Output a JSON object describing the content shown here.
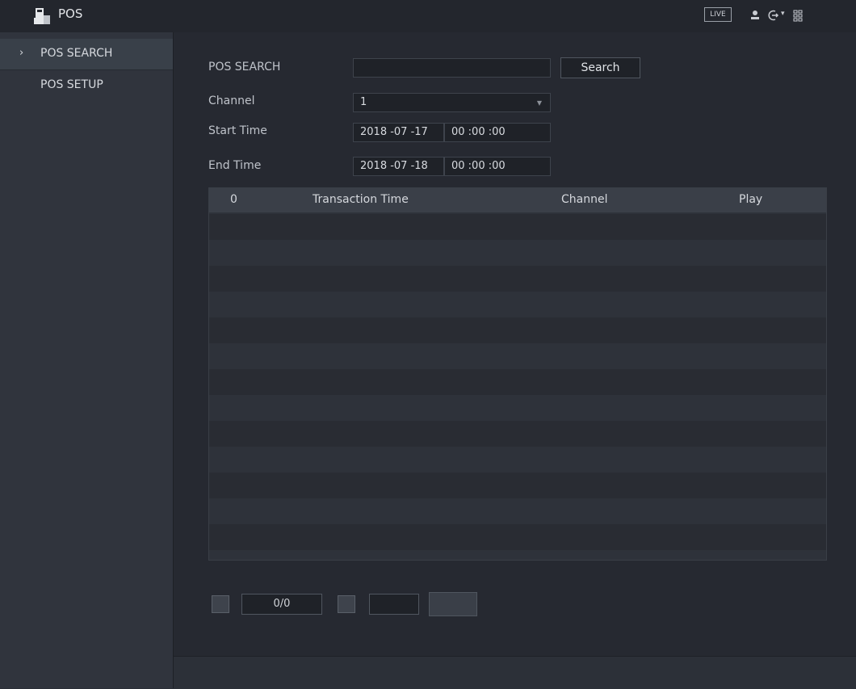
{
  "header": {
    "app_title": "POS",
    "app_icon": "pos-terminal-icon",
    "live_label": "LIVE",
    "icons": [
      "user-icon",
      "logout-icon",
      "menu-grid-icon"
    ]
  },
  "sidebar": {
    "items": [
      {
        "label": "POS SEARCH",
        "active": true
      },
      {
        "label": "POS SETUP",
        "active": false
      }
    ]
  },
  "form": {
    "search_label": "POS SEARCH",
    "search_value": "",
    "search_button": "Search",
    "channel_label": "Channel",
    "channel_value": "1",
    "start_label": "Start Time",
    "start_date": "2018 -07 -17",
    "start_time": "00 :00 :00",
    "end_label": "End Time",
    "end_date": "2018 -07 -18",
    "end_time": "00 :00 :00"
  },
  "table": {
    "columns": [
      "0",
      "Transaction Time",
      "Channel",
      "Play"
    ],
    "rows": []
  },
  "pager": {
    "page_indicator": "0/0"
  },
  "colors": {
    "background": "#262931",
    "sidebar": "#30343d",
    "topbar": "#23262d"
  }
}
